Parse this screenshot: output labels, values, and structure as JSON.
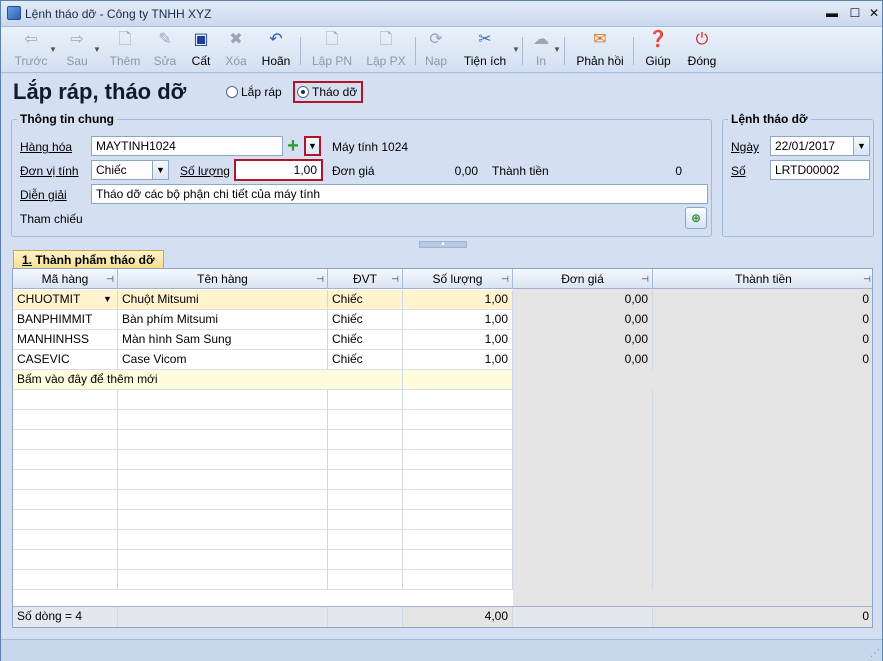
{
  "window": {
    "title": "Lệnh tháo dỡ - Công ty TNHH XYZ"
  },
  "toolbar": {
    "back": "Trước",
    "forward": "Sau",
    "add": "Thêm",
    "edit": "Sửa",
    "save": "Cất",
    "delete": "Xóa",
    "undo": "Hoãn",
    "create_pn": "Lập PN",
    "create_px": "Lập PX",
    "load": "Nạp",
    "utilities": "Tiện ích",
    "print": "In",
    "feedback": "Phản hồi",
    "help": "Giúp",
    "close": "Đóng"
  },
  "header": {
    "page_title": "Lắp ráp, tháo dỡ",
    "radio_assemble": "Lắp ráp",
    "radio_disassemble": "Tháo dỡ",
    "selected": "Tháo dỡ"
  },
  "general": {
    "group_title": "Thông tin chung",
    "goods_label": "Hàng hóa",
    "goods_value": "MAYTINH1024",
    "goods_name": "Máy tính 1024",
    "unit_label": "Đơn vị tính",
    "unit_value": "Chiếc",
    "qty_label": "Số lượng",
    "qty_value": "1,00",
    "price_label": "Đơn giá",
    "price_value": "0,00",
    "amount_label": "Thành tiền",
    "amount_value": "0",
    "desc_label": "Diễn giải",
    "desc_value": "Tháo dỡ các bộ phận chi tiết của máy tính",
    "ref_label": "Tham chiếu"
  },
  "order": {
    "group_title": "Lệnh tháo dỡ",
    "date_label": "Ngày",
    "date_value": "22/01/2017",
    "no_label": "Số",
    "no_value": "LRTD00002"
  },
  "tab": {
    "num": "1.",
    "label": " Thành phẩm tháo dỡ"
  },
  "grid": {
    "columns": [
      "Mã hàng",
      "Tên hàng",
      "ĐVT",
      "Số lượng",
      "Đơn giá",
      "Thành tiền"
    ],
    "rows": [
      [
        "CHUOTMIT",
        "Chuột Mitsumi",
        "Chiếc",
        "1,00",
        "0,00",
        "0"
      ],
      [
        "BANPHIMMIT",
        "Bàn phím Mitsumi",
        "Chiếc",
        "1,00",
        "0,00",
        "0"
      ],
      [
        "MANHINHSS",
        "Màn hình Sam Sung",
        "Chiếc",
        "1,00",
        "0,00",
        "0"
      ],
      [
        "CASEVIC",
        "Case Vicom",
        "Chiếc",
        "1,00",
        "0,00",
        "0"
      ]
    ],
    "add_new": "Bấm vào đây để thêm mới",
    "footer": {
      "row_count": "Số dòng = 4",
      "total_qty": "4,00",
      "total_amount": "0"
    }
  }
}
